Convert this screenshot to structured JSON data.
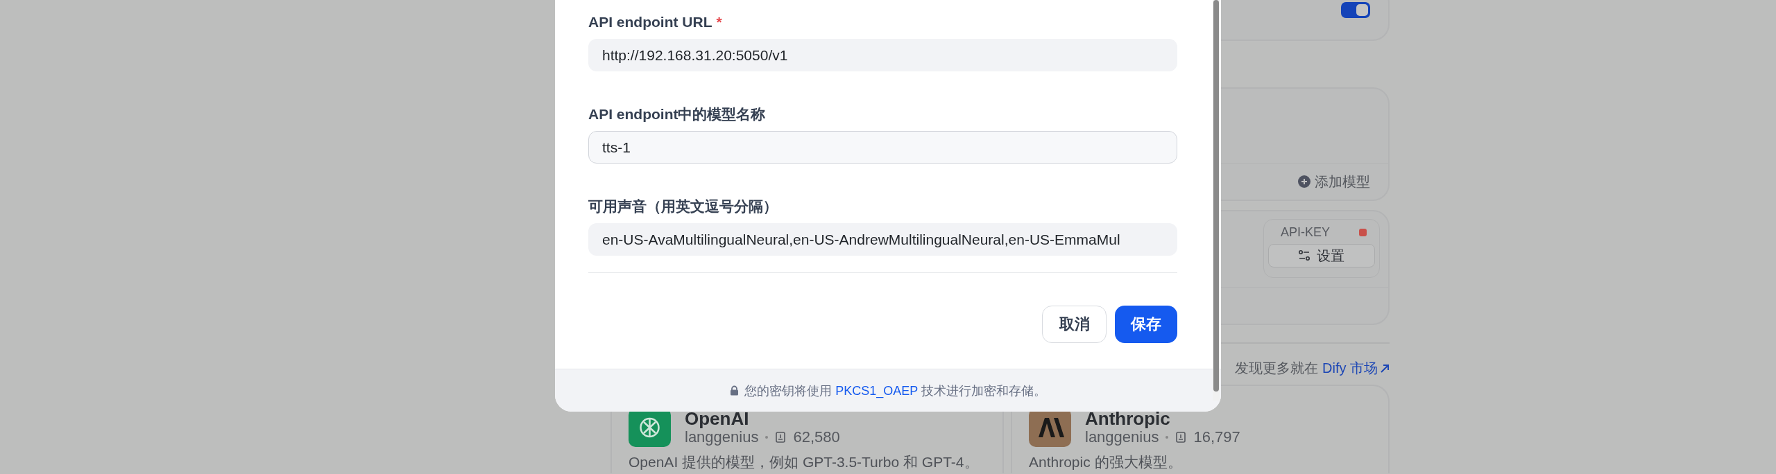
{
  "background": {
    "toggle": {
      "on": true
    },
    "add_model": "添加模型",
    "credential": {
      "label": "API-KEY",
      "configured": false,
      "settings": "设置"
    },
    "marketplace": {
      "text": "发现更多就在",
      "link": "Dify 市场"
    },
    "plugins": [
      {
        "name": "OpenAI",
        "author": "langgenius",
        "installs": "62,580",
        "description": "OpenAI 提供的模型，例如 GPT-3.5-Turbo 和 GPT-4。"
      },
      {
        "name": "Anthropic",
        "author": "langgenius",
        "installs": "16,797",
        "description": "Anthropic 的强大模型。"
      }
    ]
  },
  "dialog": {
    "fields": [
      {
        "label": "API endpoint URL",
        "required_mark": "*",
        "value": "http://192.168.31.20:5050/v1",
        "focused": false
      },
      {
        "label": "API endpoint中的模型名称",
        "value": "tts-1",
        "focused": true
      },
      {
        "label": "可用声音（用英文逗号分隔）",
        "value": "en-US-AvaMultilingualNeural,en-US-AndrewMultilingualNeural,en-US-EmmaMul",
        "focused": false
      }
    ],
    "buttons": [
      {
        "label": "取消",
        "kind": "secondary"
      },
      {
        "label": "保存",
        "kind": "primary"
      }
    ],
    "footer": {
      "before": "您的密钥将使用",
      "link": "PKCS1_OAEP",
      "after": "技术进行加密和存储。"
    }
  }
}
